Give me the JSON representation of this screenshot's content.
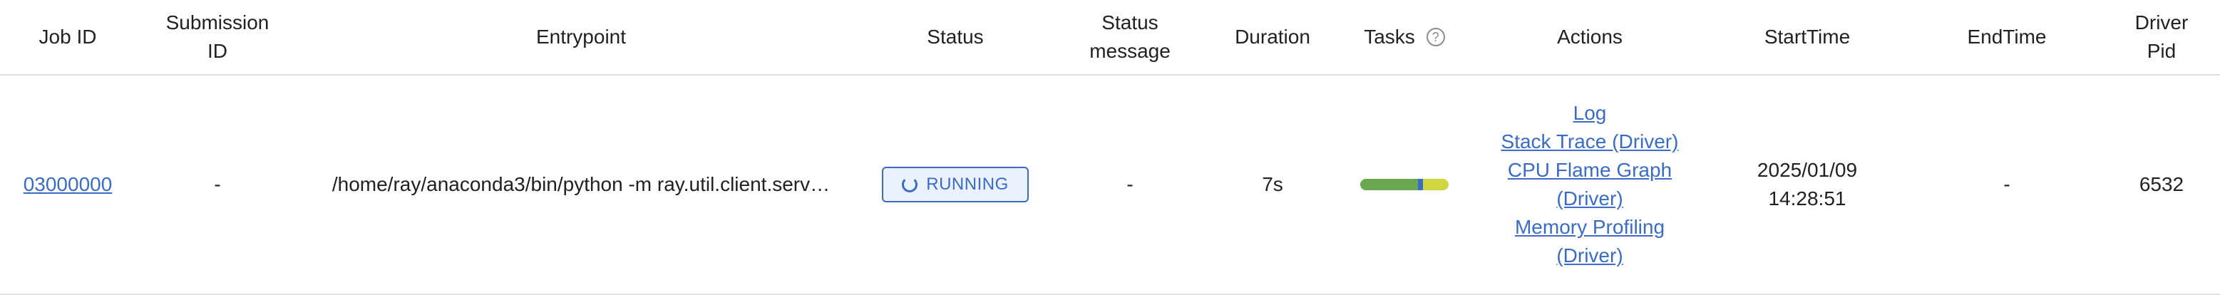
{
  "headers": {
    "job_id": "Job ID",
    "submission_id_1": "Submission",
    "submission_id_2": "ID",
    "entrypoint": "Entrypoint",
    "status": "Status",
    "status_message_1": "Status",
    "status_message_2": "message",
    "duration": "Duration",
    "tasks": "Tasks",
    "tasks_help": "?",
    "actions": "Actions",
    "start_time": "StartTime",
    "end_time": "EndTime",
    "driver_pid_1": "Driver",
    "driver_pid_2": "Pid"
  },
  "row": {
    "job_id": "03000000",
    "submission_id": "-",
    "entrypoint": "/home/ray/anaconda3/bin/python -m ray.util.client.serv…",
    "status": "RUNNING",
    "status_message": "-",
    "duration": "7s",
    "tasks_progress": {
      "finished_fraction": 0.65,
      "running_fraction": 0.06,
      "pending_fraction": 0.29,
      "colors": {
        "finished": "#6aa84f",
        "running": "#3a6cc6",
        "pending": "#cfd640"
      }
    },
    "actions": {
      "log": "Log",
      "stack_trace": "Stack Trace (Driver)",
      "cpu_flame_1": "CPU Flame Graph",
      "cpu_flame_2": "(Driver)",
      "memory_1": "Memory Profiling",
      "memory_2": "(Driver)"
    },
    "start_time_1": "2025/01/09",
    "start_time_2": "14:28:51",
    "end_time": "-",
    "driver_pid": "6532"
  },
  "colors": {
    "link": "#3a6cc6",
    "border": "#e0e0e0",
    "badge_bg": "#eaf1fb"
  }
}
